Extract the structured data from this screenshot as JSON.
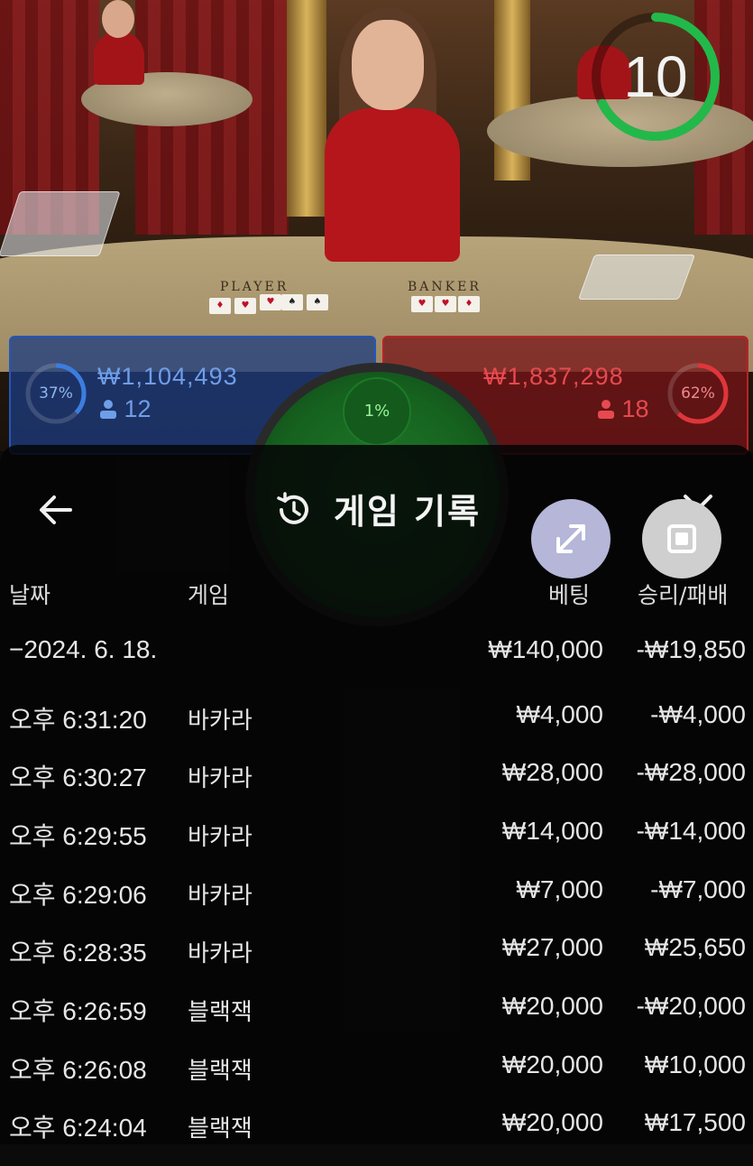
{
  "timer": {
    "value": "10",
    "color": "#22b94a"
  },
  "player": {
    "amount": "₩1,104,493",
    "count": "12",
    "percent": "37%",
    "percent_value": 0.37,
    "color": "#2a5fc4"
  },
  "banker": {
    "amount": "₩1,837,298",
    "count": "18",
    "percent": "62%",
    "percent_value": 0.62,
    "color": "#d3242a"
  },
  "tie": {
    "percent": "1%"
  },
  "table": {
    "player_label": "PLAYER",
    "banker_label": "BANKER"
  },
  "history": {
    "title": "게임 기록",
    "icons": {
      "back": "arrow-left-icon",
      "history": "history-clock-icon",
      "close": "close-icon",
      "expand": "expand-icon",
      "fullscreen": "stop-square-icon"
    },
    "headers": {
      "date": "날짜",
      "game": "게임",
      "bet": "베팅",
      "result": "승리/패배"
    },
    "summary": {
      "date": "−2024. 6. 18.",
      "bet": "₩140,000",
      "result": "-₩19,850"
    },
    "rows": [
      {
        "time": "오후 6:31:20",
        "game": "바카라",
        "bet": "₩4,000",
        "result": "-₩4,000"
      },
      {
        "time": "오후 6:30:27",
        "game": "바카라",
        "bet": "₩28,000",
        "result": "-₩28,000"
      },
      {
        "time": "오후 6:29:55",
        "game": "바카라",
        "bet": "₩14,000",
        "result": "-₩14,000"
      },
      {
        "time": "오후 6:29:06",
        "game": "바카라",
        "bet": "₩7,000",
        "result": "-₩7,000"
      },
      {
        "time": "오후 6:28:35",
        "game": "바카라",
        "bet": "₩27,000",
        "result": "₩25,650"
      },
      {
        "time": "오후 6:26:59",
        "game": "블랙잭",
        "bet": "₩20,000",
        "result": "-₩20,000"
      },
      {
        "time": "오후 6:26:08",
        "game": "블랙잭",
        "bet": "₩20,000",
        "result": "₩10,000"
      },
      {
        "time": "오후 6:24:04",
        "game": "블랙잭",
        "bet": "₩20,000",
        "result": "₩17,500"
      }
    ]
  }
}
